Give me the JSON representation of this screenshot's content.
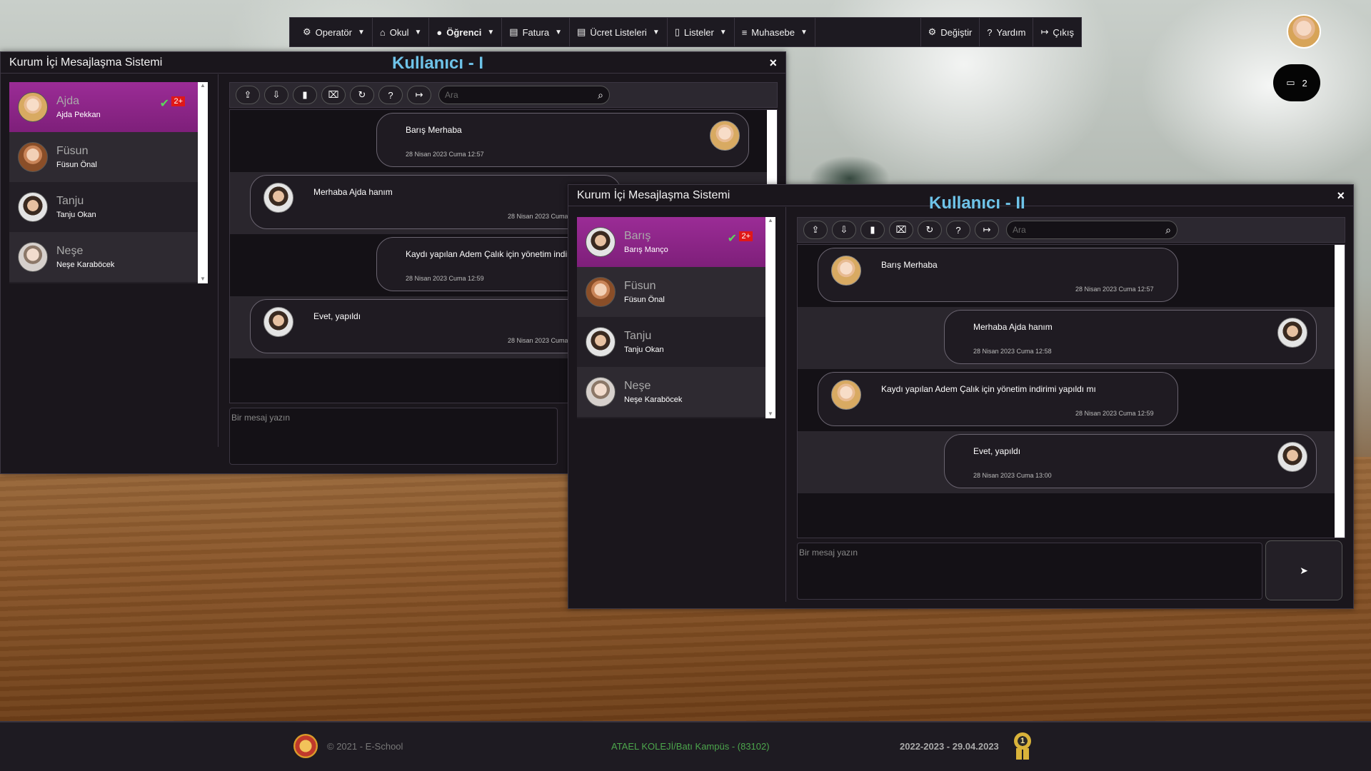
{
  "menu": {
    "items": [
      {
        "label": "Operatör",
        "icon": "gears-icon",
        "caret": true,
        "bold": false
      },
      {
        "label": "Okul",
        "icon": "home-icon",
        "caret": true,
        "bold": false
      },
      {
        "label": "Öğrenci",
        "icon": "user-icon",
        "caret": true,
        "bold": true
      },
      {
        "label": "Fatura",
        "icon": "document-icon",
        "caret": true,
        "bold": false
      },
      {
        "label": "Ücret Listeleri",
        "icon": "document-icon",
        "caret": true,
        "bold": false
      },
      {
        "label": "Listeler",
        "icon": "file-icon",
        "caret": true,
        "bold": false
      },
      {
        "label": "Muhasebe",
        "icon": "list-icon",
        "caret": true,
        "bold": false
      }
    ],
    "right": [
      {
        "label": "Değiştir",
        "icon": "gear-icon"
      },
      {
        "label": "Yardım",
        "icon": "help-icon"
      },
      {
        "label": "Çıkış",
        "icon": "logout-icon"
      }
    ]
  },
  "chat_badge": {
    "count": "2",
    "icon": "chat-icon"
  },
  "window1": {
    "title": "Kurum İçi Mesajlaşma Sistemi",
    "label": "Kullanıcı - I",
    "close": "×",
    "contacts": [
      {
        "name": "Ajda",
        "full": "Ajda Pekkan",
        "active": true,
        "check": "✔",
        "badge": "2+"
      },
      {
        "name": "Füsun",
        "full": "Füsun Önal",
        "active": false
      },
      {
        "name": "Tanju",
        "full": "Tanju Okan",
        "active": false
      },
      {
        "name": "Neşe",
        "full": "Neşe Karaböcek",
        "active": false
      }
    ],
    "search_placeholder": "Ara",
    "messages": [
      {
        "text": "Barış Merhaba",
        "time": "28 Nisan 2023 Cuma 12:57"
      },
      {
        "text": "Merhaba Ajda hanım",
        "time": "28 Nisan 2023 Cuma"
      },
      {
        "text": "Kaydı yapılan Adem Çalık için yönetim indir",
        "time": "28 Nisan 2023 Cuma 12:59"
      },
      {
        "text": "Evet, yapıldı",
        "time": "28 Nisan 2023 Cuma"
      }
    ],
    "input_placeholder": "Bir mesaj yazın"
  },
  "window2": {
    "title": "Kurum İçi Mesajlaşma Sistemi",
    "label": "Kullanıcı - II",
    "close": "×",
    "contacts": [
      {
        "name": "Barış",
        "full": "Barış Manço",
        "active": true,
        "check": "✔",
        "badge": "2+"
      },
      {
        "name": "Füsun",
        "full": "Füsun Önal",
        "active": false
      },
      {
        "name": "Tanju",
        "full": "Tanju Okan",
        "active": false
      },
      {
        "name": "Neşe",
        "full": "Neşe Karaböcek",
        "active": false
      }
    ],
    "search_placeholder": "Ara",
    "messages": [
      {
        "text": "Barış Merhaba",
        "time": "28 Nisan 2023 Cuma 12:57"
      },
      {
        "text": "Merhaba Ajda hanım",
        "time": "28 Nisan 2023 Cuma 12:58"
      },
      {
        "text": "Kaydı yapılan Adem Çalık için yönetim indirimi yapıldı mı",
        "time": "28 Nisan 2023 Cuma 12:59"
      },
      {
        "text": "Evet, yapıldı",
        "time": "28 Nisan 2023 Cuma 13:00"
      }
    ],
    "input_placeholder": "Bir mesaj yazın",
    "send_icon": "➤"
  },
  "footer": {
    "copyright": "© 2021 - E-School",
    "school": "ATAEL KOLEJİ/Batı Kampüs - (83102)",
    "date": "2022-2023 - 29.04.2023",
    "medal": "1"
  },
  "colors": {
    "accent": "#9b2c96",
    "label": "#6ec3e8",
    "success": "#4ca64c",
    "badge": "#e01818"
  }
}
